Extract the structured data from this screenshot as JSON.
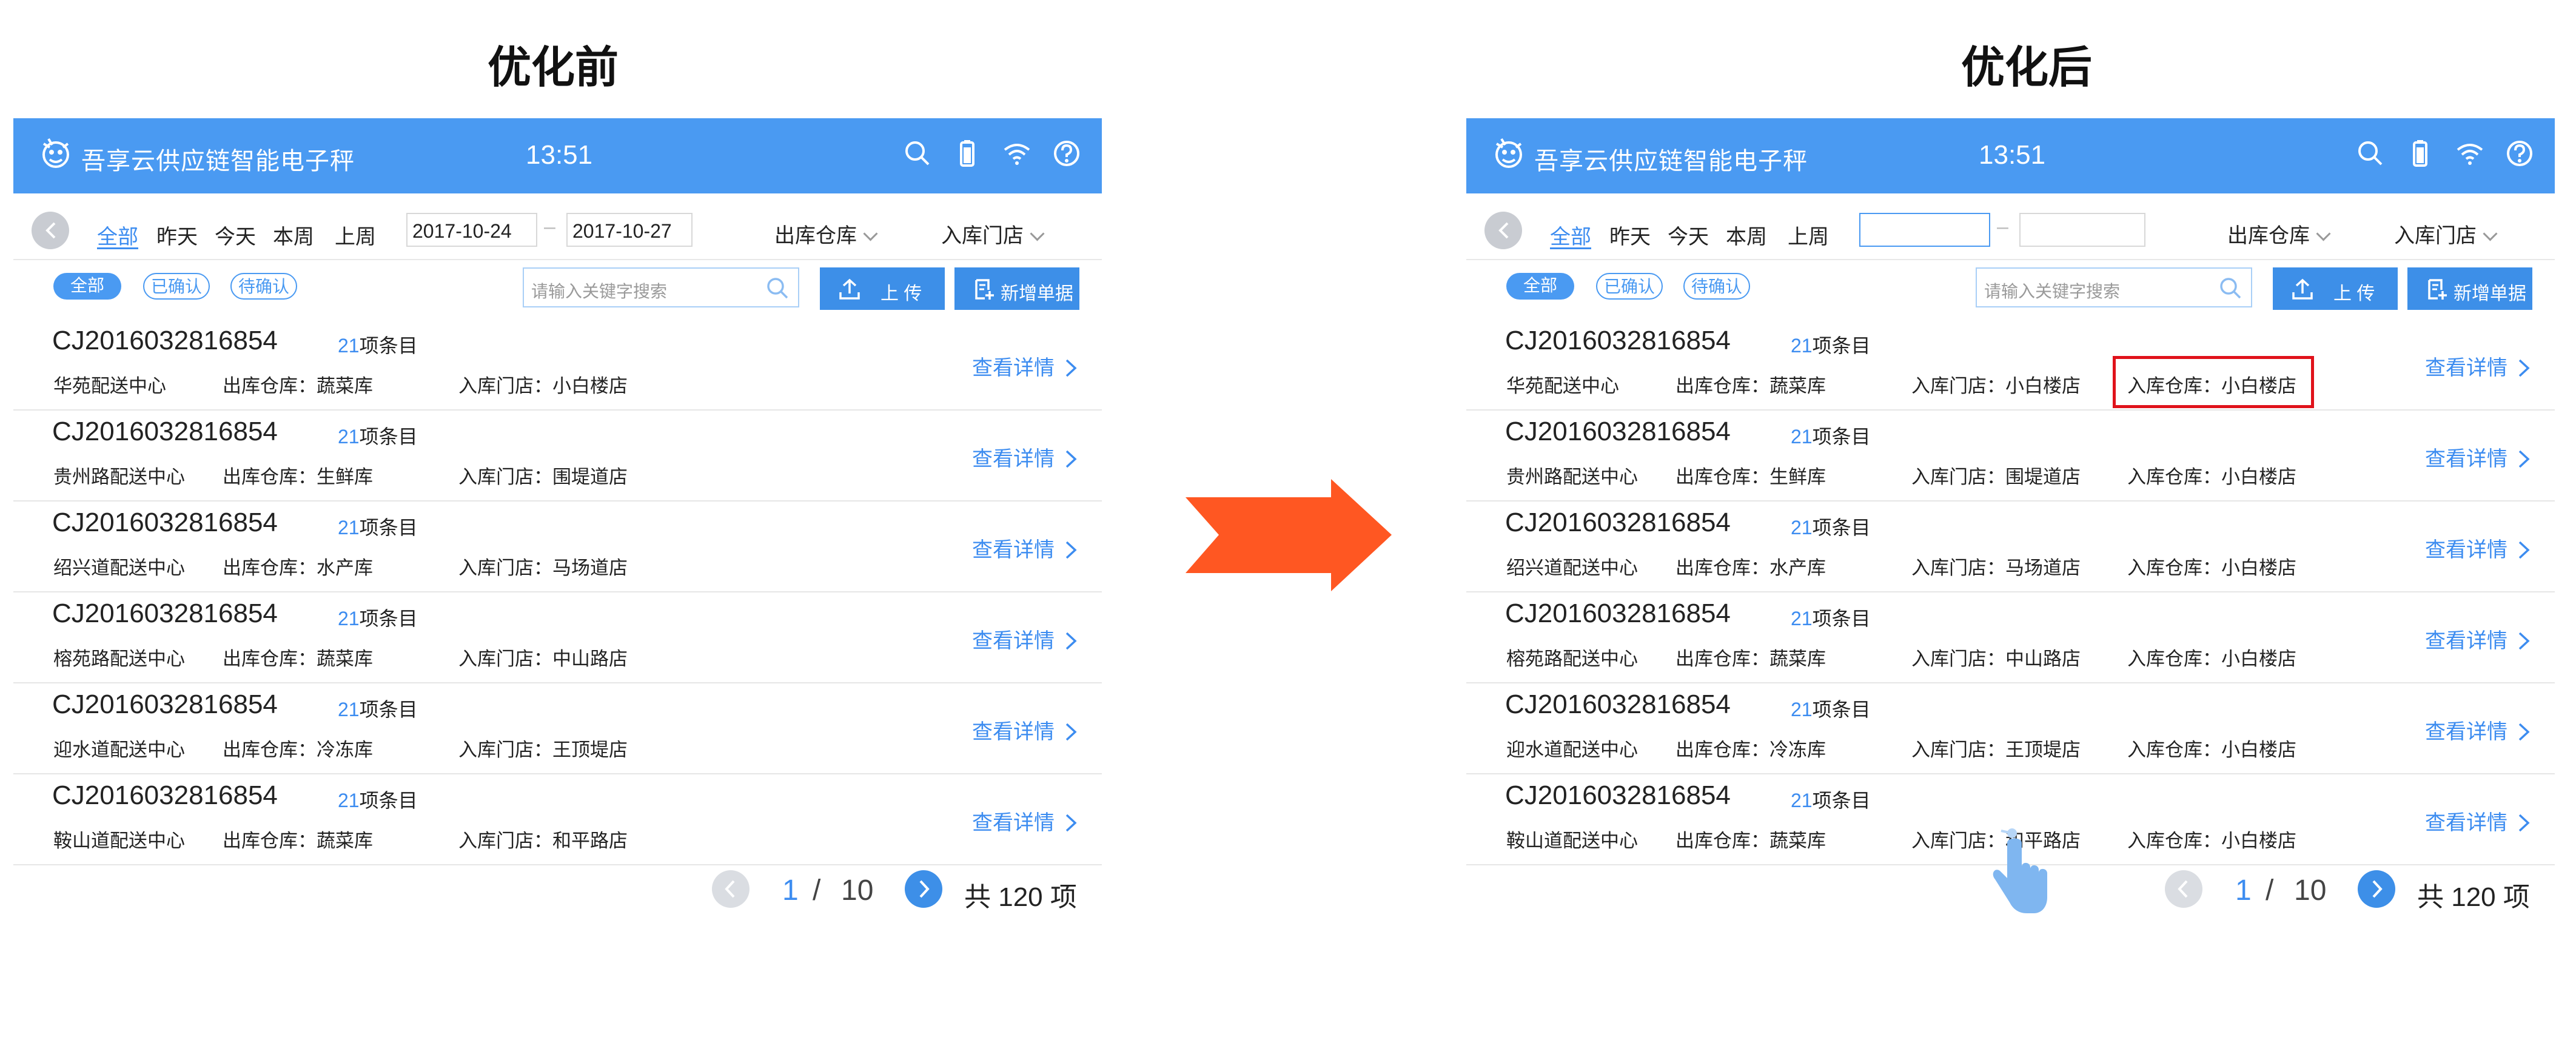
{
  "labels": {
    "before_title": "优化前",
    "after_title": "优化后"
  },
  "colors": {
    "header": "#4a9af2",
    "accent": "#3c8cf0",
    "arrow": "#ff5722",
    "highlight": "#e0121b"
  },
  "header": {
    "app_name": "吾享云供应链智能电子秤",
    "time": "13:51",
    "icons": [
      "search-icon",
      "battery-icon",
      "wifi-icon",
      "help-icon"
    ]
  },
  "filters": {
    "quick": [
      "全部",
      "昨天",
      "今天",
      "本周",
      "上周"
    ],
    "start_date_before": "2017-10-24",
    "end_date_before": "2017-10-27",
    "start_date_after": "",
    "end_date_after": "",
    "dash": "–",
    "warehouse_dropdown": "出库仓库",
    "store_dropdown": "入库门店"
  },
  "status_tabs": [
    "全部",
    "已确认",
    "待确认"
  ],
  "search": {
    "placeholder": "请输入关键字搜索"
  },
  "actions": {
    "upload": "上 传",
    "new_document": "新增单据"
  },
  "rows_before": [
    {
      "code": "CJ2016032816854",
      "count": "21",
      "count_suffix": "项条目",
      "center": "华苑配送中心",
      "out_wh": "出库仓库：蔬菜库",
      "in_store": "入库门店：小白楼店",
      "detail": "查看详情"
    },
    {
      "code": "CJ2016032816854",
      "count": "21",
      "count_suffix": "项条目",
      "center": "贵州路配送中心",
      "out_wh": "出库仓库：生鲜库",
      "in_store": "入库门店：围堤道店",
      "detail": "查看详情"
    },
    {
      "code": "CJ2016032816854",
      "count": "21",
      "count_suffix": "项条目",
      "center": "绍兴道配送中心",
      "out_wh": "出库仓库：水产库",
      "in_store": "入库门店：马场道店",
      "detail": "查看详情"
    },
    {
      "code": "CJ2016032816854",
      "count": "21",
      "count_suffix": "项条目",
      "center": "榕苑路配送中心",
      "out_wh": "出库仓库：蔬菜库",
      "in_store": "入库门店：中山路店",
      "detail": "查看详情"
    },
    {
      "code": "CJ2016032816854",
      "count": "21",
      "count_suffix": "项条目",
      "center": "迎水道配送中心",
      "out_wh": "出库仓库：冷冻库",
      "in_store": "入库门店：王顶堤店",
      "detail": "查看详情"
    },
    {
      "code": "CJ2016032816854",
      "count": "21",
      "count_suffix": "项条目",
      "center": "鞍山道配送中心",
      "out_wh": "出库仓库：蔬菜库",
      "in_store": "入库门店：和平路店",
      "detail": "查看详情"
    }
  ],
  "rows_after": [
    {
      "code": "CJ2016032816854",
      "count": "21",
      "count_suffix": "项条目",
      "center": "华苑配送中心",
      "out_wh": "出库仓库：蔬菜库",
      "in_store": "入库门店：小白楼店",
      "in_wh": "入库仓库：小白楼店",
      "detail": "查看详情"
    },
    {
      "code": "CJ2016032816854",
      "count": "21",
      "count_suffix": "项条目",
      "center": "贵州路配送中心",
      "out_wh": "出库仓库：生鲜库",
      "in_store": "入库门店：围堤道店",
      "in_wh": "入库仓库：小白楼店",
      "detail": "查看详情"
    },
    {
      "code": "CJ2016032816854",
      "count": "21",
      "count_suffix": "项条目",
      "center": "绍兴道配送中心",
      "out_wh": "出库仓库：水产库",
      "in_store": "入库门店：马场道店",
      "in_wh": "入库仓库：小白楼店",
      "detail": "查看详情"
    },
    {
      "code": "CJ2016032816854",
      "count": "21",
      "count_suffix": "项条目",
      "center": "榕苑路配送中心",
      "out_wh": "出库仓库：蔬菜库",
      "in_store": "入库门店：中山路店",
      "in_wh": "入库仓库：小白楼店",
      "detail": "查看详情"
    },
    {
      "code": "CJ2016032816854",
      "count": "21",
      "count_suffix": "项条目",
      "center": "迎水道配送中心",
      "out_wh": "出库仓库：冷冻库",
      "in_store": "入库门店：王顶堤店",
      "in_wh": "入库仓库：小白楼店",
      "detail": "查看详情"
    },
    {
      "code": "CJ2016032816854",
      "count": "21",
      "count_suffix": "项条目",
      "center": "鞍山道配送中心",
      "out_wh": "出库仓库：蔬菜库",
      "in_store": "入库门店：和平路店",
      "in_wh": "入库仓库：小白楼店",
      "detail": "查看详情"
    }
  ],
  "pagination": {
    "current": "1",
    "separator": "/",
    "pages": "10",
    "total": "共 120 项"
  }
}
